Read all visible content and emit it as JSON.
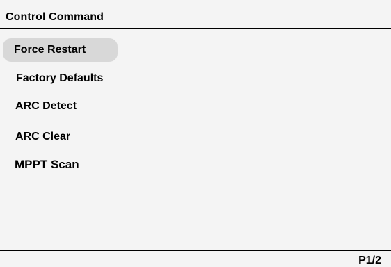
{
  "header": {
    "title": "Control Command"
  },
  "menu": {
    "items": [
      {
        "label": "Force Restart",
        "selected": true
      },
      {
        "label": "Factory Defaults",
        "selected": false
      },
      {
        "label": "ARC Detect",
        "selected": false
      },
      {
        "label": "ARC Clear",
        "selected": false
      },
      {
        "label": "MPPT Scan",
        "selected": false
      }
    ]
  },
  "footer": {
    "page_indicator": "P1/2"
  },
  "colors": {
    "background": "#f4f4f4",
    "selected_highlight": "#d8d8d8",
    "text": "#000000"
  }
}
